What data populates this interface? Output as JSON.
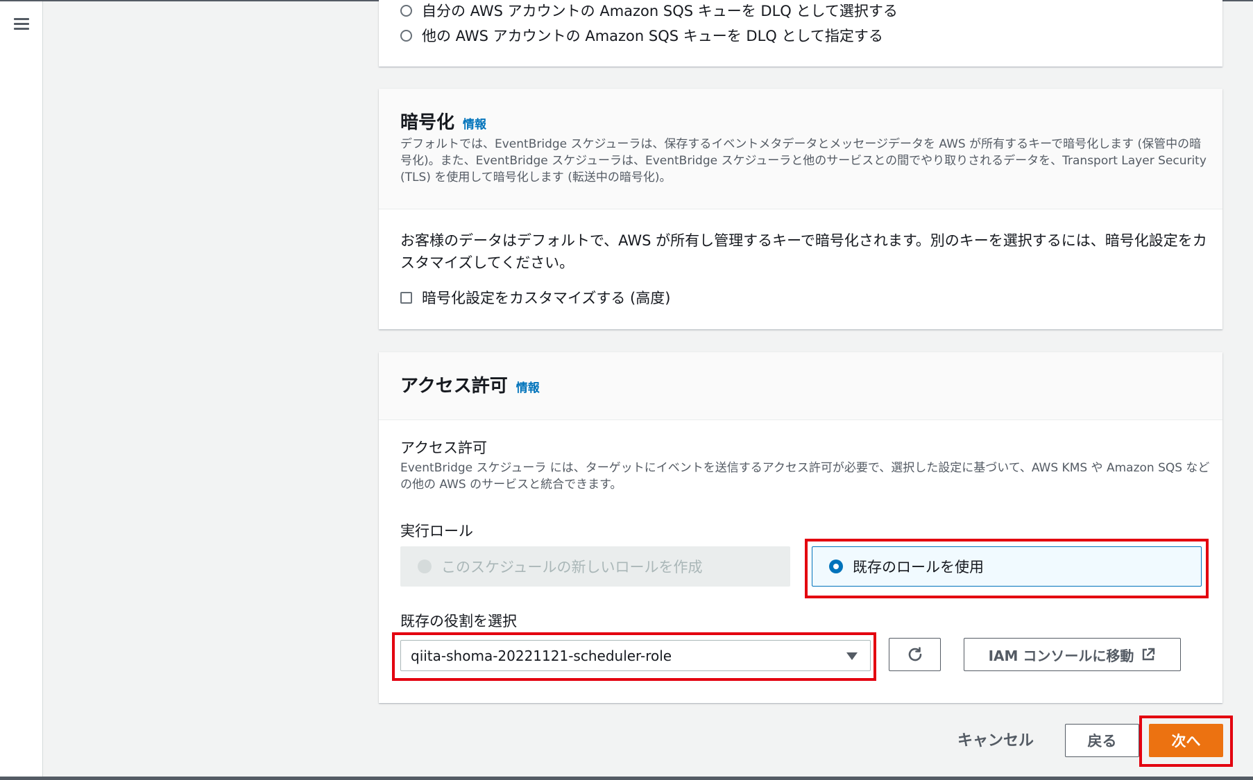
{
  "dlq": {
    "option_own_account": "自分の AWS アカウントの Amazon SQS キューを DLQ として選択する",
    "option_other_account": "他の AWS アカウントの Amazon SQS キューを DLQ として指定する"
  },
  "encryption": {
    "title": "暗号化",
    "info": "情報",
    "description": "デフォルトでは、EventBridge スケジューラは、保存するイベントメタデータとメッセージデータを AWS が所有するキーで暗号化します (保管中の暗号化)。また、EventBridge スケジューラは、EventBridge スケジューラと他のサービスとの間でやり取りされるデータを、Transport Layer Security (TLS) を使用して暗号化します (転送中の暗号化)。",
    "body": "お客様のデータはデフォルトで、AWS が所有し管理するキーで暗号化されます。別のキーを選択するには、暗号化設定をカスタマイズしてください。",
    "customize_label": "暗号化設定をカスタマイズする (高度)"
  },
  "permissions": {
    "title": "アクセス許可",
    "info": "情報",
    "field_label": "アクセス許可",
    "field_desc": "EventBridge スケジューラ には、ターゲットにイベントを送信するアクセス許可が必要で、選択した設定に基づいて、AWS KMS や Amazon SQS などの他の AWS のサービスと統合できます。",
    "role_label": "実行ロール",
    "tile_new": "このスケジュールの新しいロールを作成",
    "tile_existing": "既存のロールを使用",
    "select_label": "既存の役割を選択",
    "selected_role": "qiita-shoma-20221121-scheduler-role",
    "iam_button": "IAM コンソールに移動"
  },
  "footer": {
    "cancel": "キャンセル",
    "back": "戻る",
    "next": "次へ"
  },
  "colors": {
    "primary": "#ec7211",
    "link": "#0073bb",
    "highlight": "#e3000f"
  }
}
